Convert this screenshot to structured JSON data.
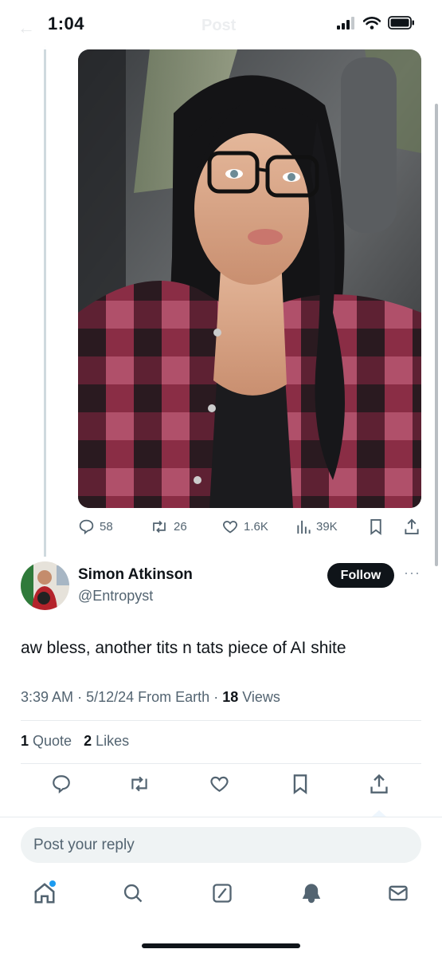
{
  "status_bar": {
    "time": "1:04",
    "ghost_title": "Post"
  },
  "media": {
    "alt": "Selfie photo of a woman in a car"
  },
  "post_actions": {
    "replies": "58",
    "reposts": "26",
    "likes": "1.6K",
    "views": "39K"
  },
  "reply": {
    "author_name": "Simon Atkinson",
    "author_handle": "@Entropyst",
    "follow_label": "Follow",
    "more_label": "···",
    "text": "aw bless, another tits n tats piece of AI shite",
    "time": "3:39 AM",
    "date": "5/12/24",
    "source": "From Earth",
    "views_count": "18",
    "views_label": "Views",
    "quotes_count": "1",
    "quotes_label": "Quote",
    "likes_count": "2",
    "likes_label": "Likes"
  },
  "composer": {
    "placeholder": "Post your reply"
  },
  "colors": {
    "accent": "#1d9bf0",
    "text": "#0f1419",
    "muted": "#536471"
  },
  "tabbar": [
    "home-icon",
    "search-icon",
    "grok-icon",
    "notifications-icon",
    "messages-icon"
  ]
}
